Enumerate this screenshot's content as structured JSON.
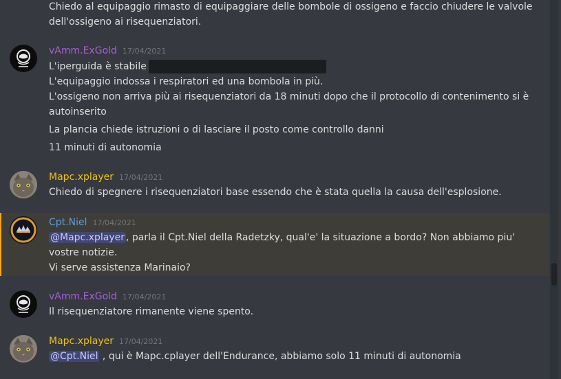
{
  "prev_message": {
    "lines": [
      "Chiedo al equipaggio rimasto di equipaggiare delle bombole di ossigeno e faccio chiudere le valvole",
      "dell'ossigeno ai risequenziatori."
    ]
  },
  "messages": [
    {
      "username": "vAmm.ExGold",
      "timestamp": "17/04/2021",
      "avatar_icon": "astronaut-icon",
      "username_color": "#a560d8",
      "lines": [
        "L'iperguida è stabile",
        "L'equipaggio indossa i respiratori ed una bombola in più.",
        "L'ossigeno non arriva più ai risequenziatori da 18 minuti dopo che il protocollo di contenimento si è",
        "autoinserito",
        "La plancia chiede istruzioni o di lasciare il posto come controllo danni",
        "11 minuti di autonomia"
      ]
    },
    {
      "username": "Mapc.xplayer",
      "timestamp": "17/04/2021",
      "avatar_icon": "cat-icon",
      "username_color": "#f1c40f",
      "lines": [
        "Chiedo di spegnere i risequenziatori base essendo che è stata quella la causa dell'esplosione."
      ]
    },
    {
      "username": "Cpt.Niel",
      "timestamp": "17/04/2021",
      "avatar_icon": "ring-icon",
      "username_color": "#5d9edb",
      "mention": "@Mapc.xplayer",
      "lines": [
        ", parla il Cpt.Niel della Radetzky, qual'e' la situazione a bordo? Non abbiamo piu'",
        "vostre notizie.",
        "Vi serve assistenza Marinaio?"
      ]
    },
    {
      "username": "vAmm.ExGold",
      "timestamp": "17/04/2021",
      "avatar_icon": "astronaut-icon",
      "username_color": "#a560d8",
      "lines": [
        "Il risequenziatore rimanente viene spento."
      ]
    },
    {
      "username": "Mapc.xplayer",
      "timestamp": "17/04/2021",
      "avatar_icon": "cat-icon",
      "username_color": "#f1c40f",
      "mention": "@Cpt.Niel",
      "lines": [
        " , qui è  Mapc.cplayer dell'Endurance, abbiamo solo 11 minuti di autonomia"
      ]
    }
  ],
  "colors": {
    "background": "#36393f",
    "mention_highlight": "#faa61a",
    "mention_chip": "#414675"
  }
}
